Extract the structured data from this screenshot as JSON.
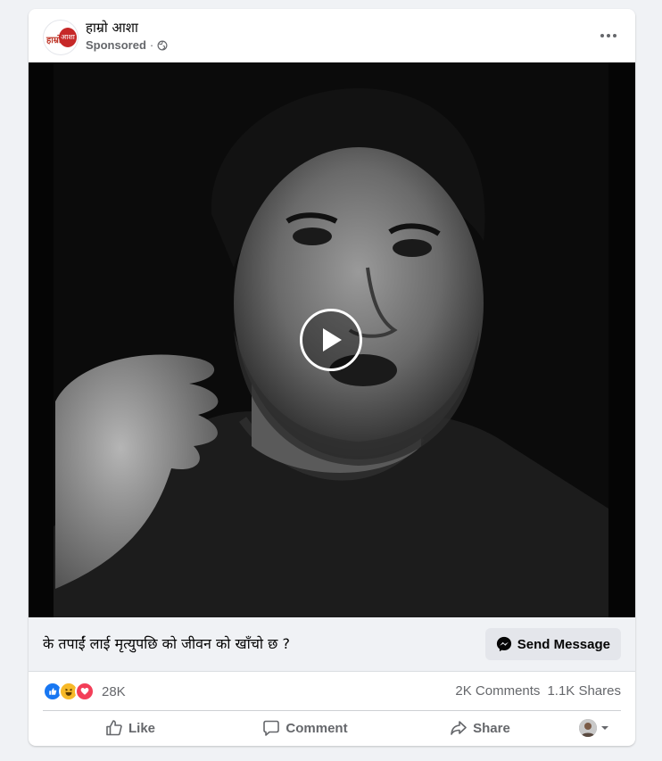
{
  "post": {
    "page_name": "हाम्रो आशा",
    "sponsored_label": "Sponsored",
    "separator": "·",
    "logo_text_left": "हाम्रो",
    "logo_text_right": "आशा"
  },
  "caption": {
    "text": "के तपाईं लाई मृत्युपछि को जीवन को खाँचो छ ?",
    "send_message_label": "Send Message"
  },
  "stats": {
    "reaction_count": "28K",
    "comments": "2K Comments",
    "shares": "1.1K Shares",
    "reactions": [
      "like",
      "haha",
      "love"
    ]
  },
  "actions": {
    "like_label": "Like",
    "comment_label": "Comment",
    "share_label": "Share"
  },
  "colors": {
    "like_blue": "#1877f2",
    "haha_yellow": "#f7b928",
    "love_red": "#f33e58",
    "logo_red": "#c62828"
  }
}
